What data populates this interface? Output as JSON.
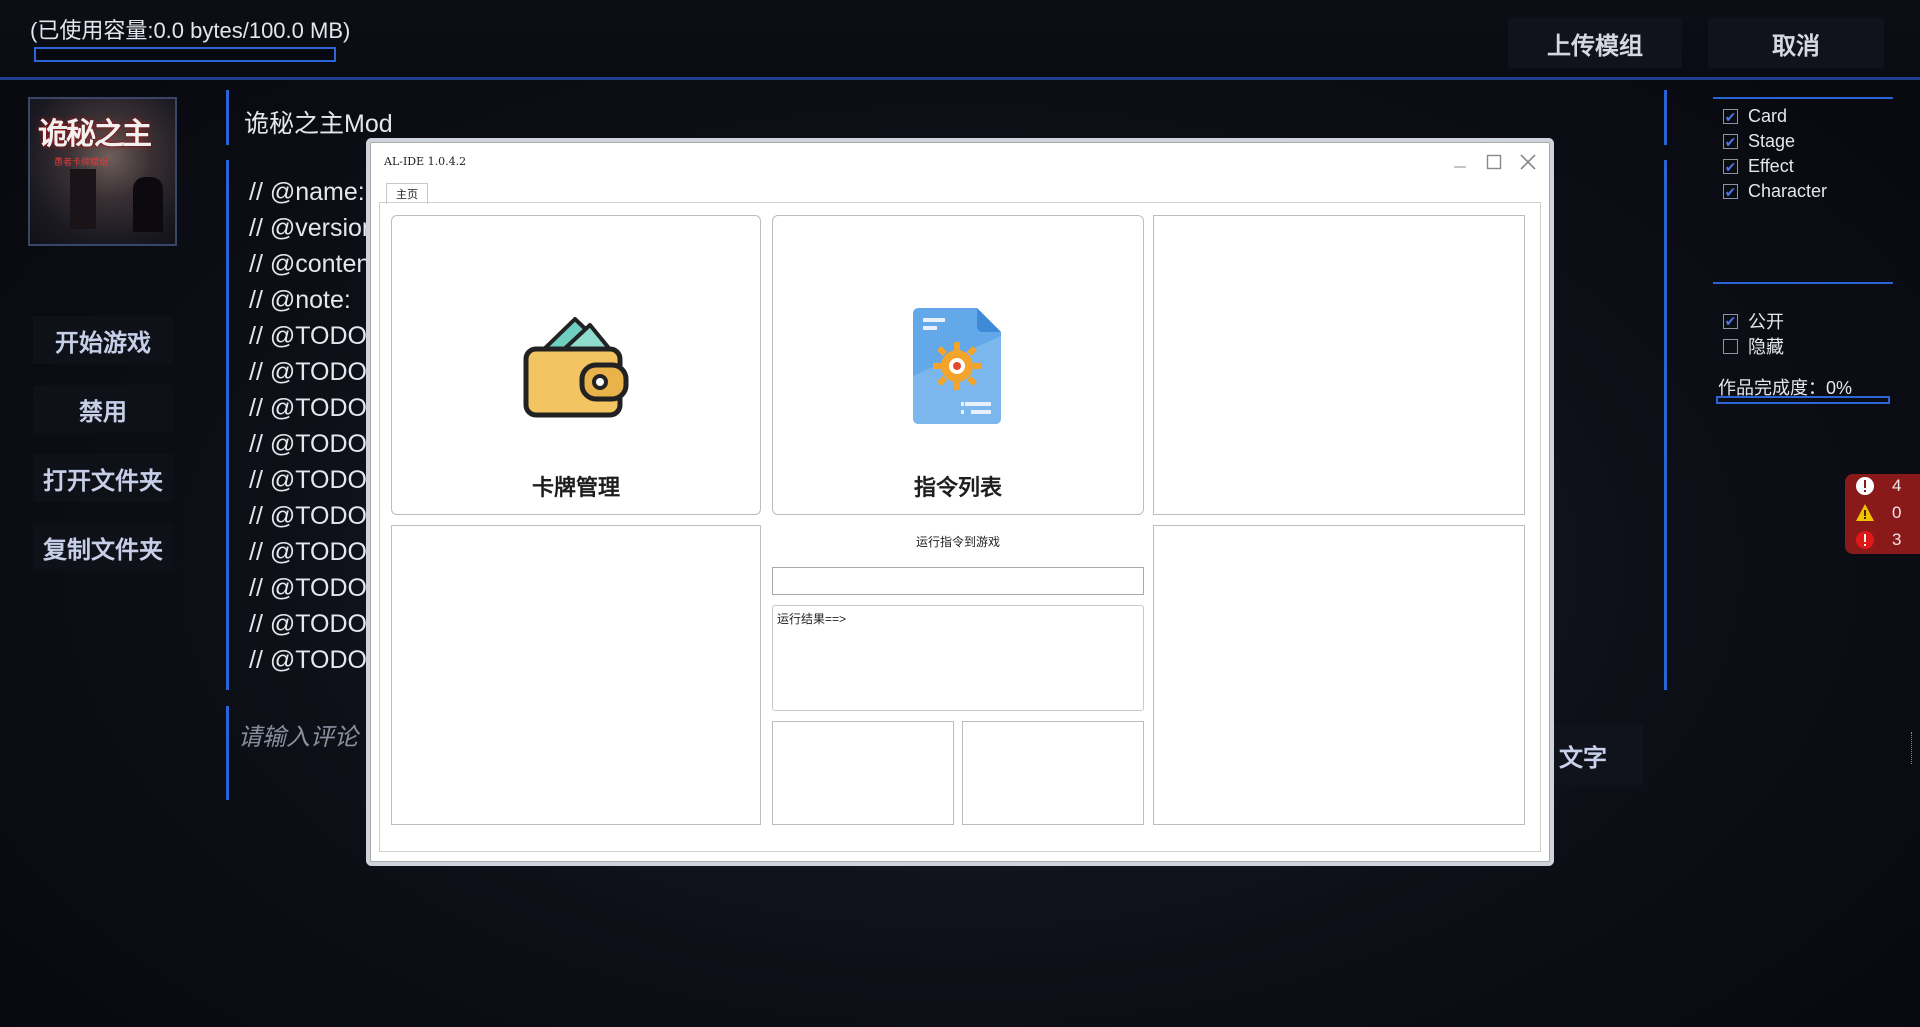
{
  "header": {
    "capacity_text": "(已使用容量:0.0 bytes/100.0 MB)",
    "capacity_fraction": 0.0,
    "upload_label": "上传模组",
    "cancel_label": "取消"
  },
  "mod": {
    "thumbnail_title": "诡秘之主",
    "thumbnail_subtitle": "愚者卡牌模组",
    "title": "诡秘之主Mod",
    "code_lines": [
      "// @name:",
      "// @version",
      "// @conten",
      "// @note:",
      "// @TODO[",
      "// @TODO[",
      "// @TODO[",
      "// @TODO[",
      "// @TODO[",
      "// @TODO[",
      "// @TODO[",
      "// @TODO[",
      "// @TODO[",
      "// @TODO["
    ],
    "comment_placeholder": "请输入评论",
    "text_button": "文字"
  },
  "sidebar": {
    "buttons": [
      "开始游戏",
      "禁用",
      "打开文件夹",
      "复制文件夹"
    ]
  },
  "tags": [
    {
      "label": "Card",
      "checked": true
    },
    {
      "label": "Stage",
      "checked": true
    },
    {
      "label": "Effect",
      "checked": true
    },
    {
      "label": "Character",
      "checked": true
    }
  ],
  "visibility": [
    {
      "label": "公开",
      "checked": true
    },
    {
      "label": "隐藏",
      "checked": false
    }
  ],
  "completion": {
    "label": "作品完成度：0%",
    "fraction": 0.0
  },
  "issues": {
    "info": "4",
    "warnings": "0",
    "errors": "3",
    "colors": {
      "info": "#ffffff",
      "warning": "#f2c200",
      "error": "#e01818"
    }
  },
  "ide": {
    "title": "AL-IDE 1.0.4.2",
    "tab": "主页",
    "tile_card_manage": "卡牌管理",
    "tile_command_list": "指令列表",
    "run_label": "运行指令到游戏",
    "result_label": "运行结果==>",
    "icons": {
      "card_manage": "wallet-icon",
      "command_list": "settings-document-icon"
    }
  },
  "colors": {
    "accent": "#2a63d4",
    "background": "#0d0f17"
  }
}
